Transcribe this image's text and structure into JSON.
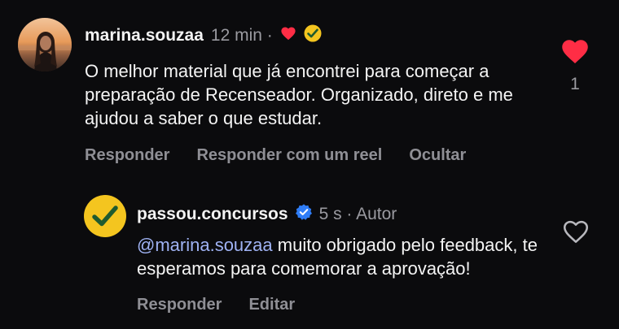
{
  "comment": {
    "username": "marina.souzaa",
    "time": "12 min",
    "separator": "·",
    "text": "O melhor material que já encontrei para começar a preparação de Recenseador. Organizado, direto e me ajudou a saber o que estudar.",
    "likes": "1",
    "actions": {
      "reply": "Responder",
      "reply_reel": "Responder com um reel",
      "hide": "Ocultar"
    }
  },
  "reply": {
    "username": "passou.concursos",
    "time": "5 s",
    "separator": "·",
    "author_label": "Autor",
    "mention": "@marina.souzaa",
    "text": " muito obrigado pelo feedback, te esperamos para comemorar a aprovação!",
    "actions": {
      "reply": "Responder",
      "edit": "Editar"
    }
  },
  "colors": {
    "heart_red": "#ff2d45",
    "brand_yellow": "#f4c51f",
    "verified_blue": "#2f7df6",
    "mention_blue": "#9fb2f3"
  },
  "icons": {
    "liked": "heart-filled-icon",
    "unliked": "heart-outline-icon",
    "verified": "verified-badge-icon",
    "check": "checkmark-icon"
  }
}
